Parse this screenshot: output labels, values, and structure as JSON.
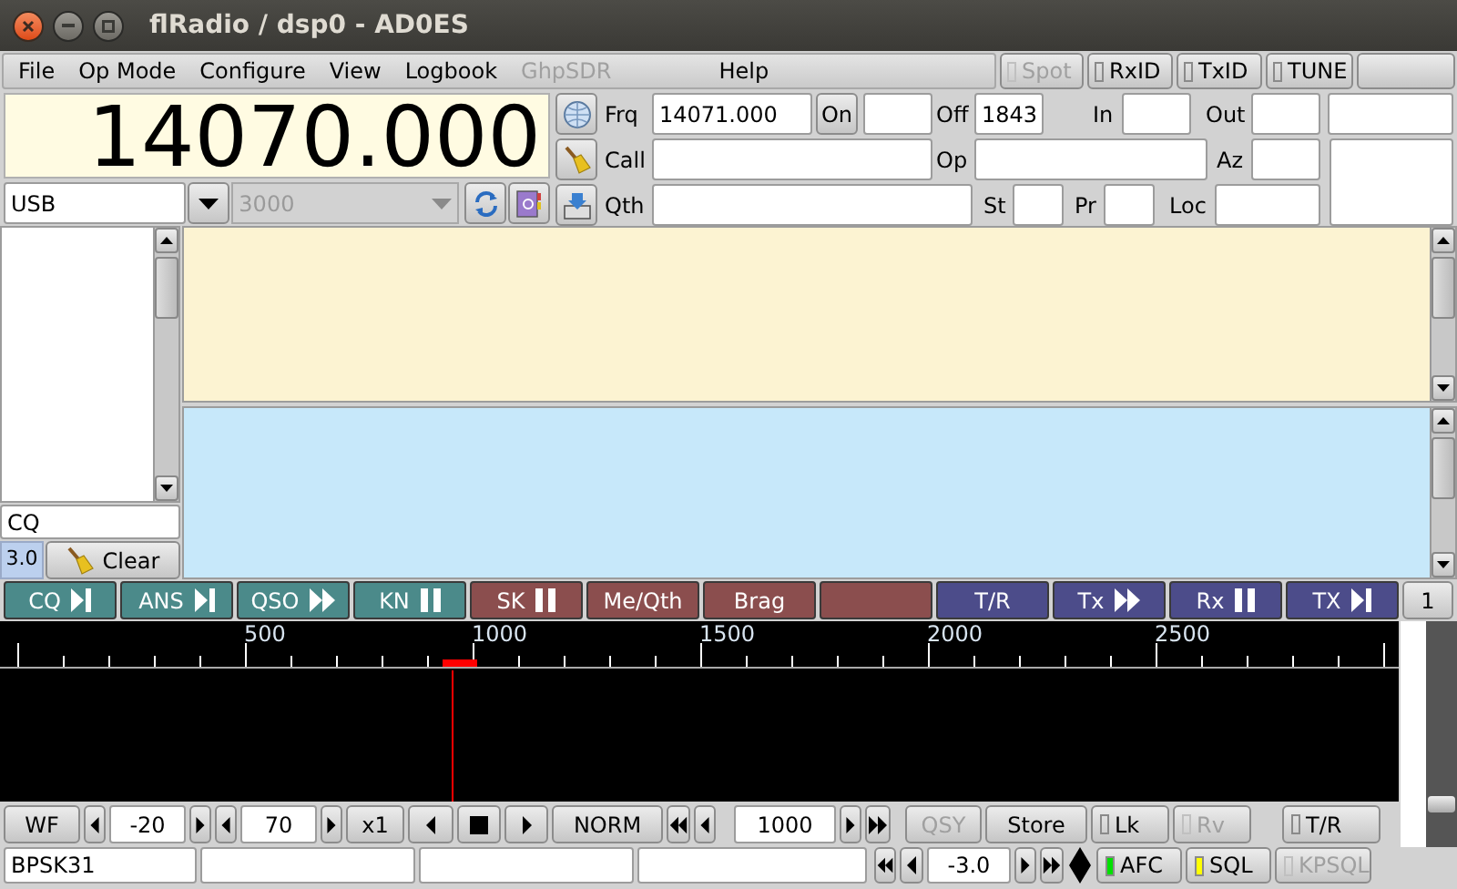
{
  "window": {
    "title": "flRadio / dsp0 - AD0ES"
  },
  "menu": [
    {
      "label": "File",
      "disabled": false
    },
    {
      "label": "Op Mode",
      "disabled": false
    },
    {
      "label": "Configure",
      "disabled": false
    },
    {
      "label": "View",
      "disabled": false
    },
    {
      "label": "Logbook",
      "disabled": false
    },
    {
      "label": "GhpSDR",
      "disabled": true
    },
    {
      "label": "Help",
      "disabled": false
    }
  ],
  "menu_toggles": [
    {
      "label": "Spot",
      "checked": false,
      "disabled": true
    },
    {
      "label": "RxID",
      "checked": false,
      "disabled": false
    },
    {
      "label": "TxID",
      "checked": false,
      "disabled": false
    },
    {
      "label": "TUNE",
      "checked": false,
      "disabled": false
    }
  ],
  "frequency": "14070.000",
  "mode": {
    "value": "USB"
  },
  "bandwidth": {
    "value": "3000",
    "disabled": true
  },
  "log": {
    "frq": {
      "label": "Frq",
      "value": "14071.000"
    },
    "on_button": "On",
    "off": {
      "label": "Off",
      "value": "1843"
    },
    "in": {
      "label": "In"
    },
    "out": {
      "label": "Out"
    },
    "call": {
      "label": "Call"
    },
    "op": {
      "label": "Op"
    },
    "az": {
      "label": "Az"
    },
    "qth": {
      "label": "Qth"
    },
    "st": {
      "label": "St"
    },
    "pr": {
      "label": "Pr"
    },
    "loc": {
      "label": "Loc"
    }
  },
  "left_panel": {
    "cq_field": "CQ",
    "speed": "3.0",
    "clear_button": "Clear"
  },
  "macros": [
    {
      "label": "CQ",
      "kind": "step",
      "color": "#4b8a8a"
    },
    {
      "label": "ANS",
      "kind": "step",
      "color": "#4b8a8a"
    },
    {
      "label": "QSO",
      "kind": "forward",
      "color": "#4b8a8a"
    },
    {
      "label": "KN",
      "kind": "pause",
      "color": "#4b8a8a"
    },
    {
      "label": "SK",
      "kind": "pause",
      "color": "#8b4e4e"
    },
    {
      "label": "Me/Qth",
      "kind": "none",
      "color": "#8b4e4e"
    },
    {
      "label": "Brag",
      "kind": "none",
      "color": "#8b4e4e"
    },
    {
      "kind": "none",
      "color": "#8b4e4e"
    },
    {
      "label": "T/R",
      "kind": "none",
      "color": "#4c4c8a"
    },
    {
      "label": "Tx",
      "kind": "forward",
      "color": "#4c4c8a"
    },
    {
      "label": "Rx",
      "kind": "pause",
      "color": "#4c4c8a"
    },
    {
      "label": "TX",
      "kind": "step",
      "color": "#4c4c8a"
    }
  ],
  "macro_bank": "1",
  "waterfall": {
    "scale": [
      "500",
      "1000",
      "1500",
      "2000",
      "2500"
    ]
  },
  "waterfall_slider": {
    "level": 0.15
  },
  "waterfall_controls": [
    {
      "kind": "button",
      "label": "WF",
      "disabled": false
    },
    {
      "kind": "left"
    },
    {
      "kind": "field",
      "value": "-20"
    },
    {
      "kind": "right"
    },
    {
      "kind": "left"
    },
    {
      "kind": "field",
      "value": "70"
    },
    {
      "kind": "right"
    },
    {
      "kind": "button",
      "label": "x1",
      "disabled": false
    },
    {
      "kind": "left"
    },
    {
      "kind": "stop"
    },
    {
      "kind": "right"
    },
    {
      "kind": "button",
      "label": "NORM",
      "disabled": false
    },
    {
      "kind": "rewind"
    },
    {
      "kind": "left"
    },
    {
      "kind": "field",
      "value": "1000"
    },
    {
      "kind": "right"
    },
    {
      "kind": "forward"
    },
    {
      "kind": "button",
      "label": "QSY",
      "disabled": true
    },
    {
      "kind": "button",
      "label": "Store",
      "disabled": false
    },
    {
      "kind": "toggle",
      "label": "Lk",
      "checked": false,
      "disabled": false
    },
    {
      "kind": "toggle",
      "label": "Rv",
      "checked": false,
      "disabled": true
    },
    {
      "kind": "toggle",
      "label": "T/R",
      "checked": false,
      "disabled": false
    }
  ],
  "status_bar": {
    "mode": "BPSK31"
  },
  "status_controls": [
    {
      "kind": "rewind"
    },
    {
      "kind": "left"
    },
    {
      "kind": "field",
      "value": "-3.0"
    },
    {
      "kind": "right"
    },
    {
      "kind": "forward"
    },
    {
      "kind": "diamond"
    },
    {
      "kind": "toggle",
      "label": "AFC",
      "checked": true,
      "disabled": false,
      "color": "#00e000"
    },
    {
      "kind": "toggle",
      "label": "SQL",
      "checked": true,
      "disabled": false,
      "color": "#ffff00"
    },
    {
      "kind": "toggle",
      "label": "KPSQL",
      "checked": false,
      "disabled": true
    }
  ]
}
